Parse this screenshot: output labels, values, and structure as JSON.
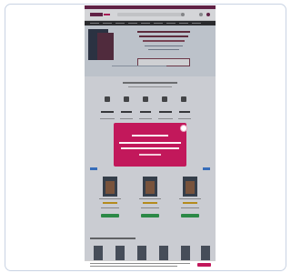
{
  "page": {
    "accent": "#c2185b",
    "brand_bar": "#6e2048",
    "nav_bg": "#2b2b2b",
    "frame_border": "#c9d3e3"
  },
  "header": {
    "logo_icon": "store-logo",
    "search_icon": "search-icon",
    "account_icon": "user-icon",
    "cart_icon": "cart-icon"
  },
  "hero": {
    "has_cta_button": true
  },
  "stats": {
    "icons": [
      "book-icon",
      "users-icon",
      "store-icon",
      "truck-icon",
      "trophy-icon"
    ]
  },
  "popup": {
    "close_icon": "close-icon",
    "color": "#c2185b"
  },
  "products": {
    "cards": 3,
    "tag_color": "#3a7bd5",
    "price_color": "#d4a017",
    "buy_color": "#2e9e4a"
  },
  "cookie_bar": {
    "button_color": "#c2185b"
  }
}
